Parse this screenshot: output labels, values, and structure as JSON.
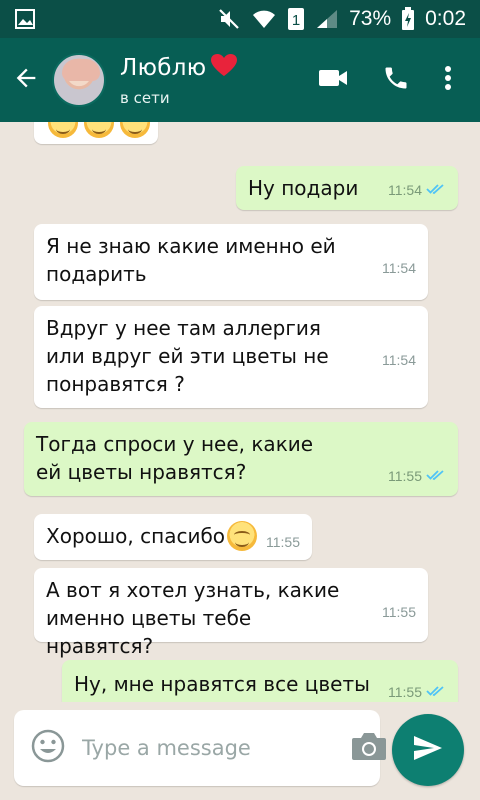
{
  "status_bar": {
    "battery": "73%",
    "time": "0:02",
    "sim_slot": "1"
  },
  "header": {
    "contact_name": "Люблю",
    "presence": "в сети",
    "icons": [
      "back-arrow-icon",
      "video-call-icon",
      "phone-icon",
      "more-vert-icon"
    ]
  },
  "messages": [
    {
      "dir": "in",
      "text": "",
      "emojis": 3,
      "time": ""
    },
    {
      "dir": "out",
      "text": "Ну подари",
      "time": "11:54",
      "read": true
    },
    {
      "dir": "in",
      "text": "Я не знаю какие именно ей подарить",
      "time": "11:54"
    },
    {
      "dir": "in",
      "text": "Вдруг у нее там аллергия или вдруг ей эти цветы не понравятся ?",
      "time": "11:54"
    },
    {
      "dir": "out",
      "text": "Тогда спроси у нее, какие ей цветы нравятся?",
      "time": "11:55",
      "read": true
    },
    {
      "dir": "in",
      "text": "Хорошо, спасибо",
      "time": "11:55",
      "emoji_after": true
    },
    {
      "dir": "in",
      "text": "А вот я хотел узнать, какие именно цветы тебе нравятся?",
      "time": "11:55"
    },
    {
      "dir": "out",
      "text": "Ну, мне нравятся все цветы",
      "time": "11:55",
      "read": true
    }
  ],
  "composer": {
    "placeholder": "Type a message",
    "icons": [
      "emoji-icon",
      "camera-icon",
      "send-icon"
    ]
  },
  "colors": {
    "statusbar": "#0b4f47",
    "appbar": "#075e54",
    "incoming": "#ffffff",
    "outgoing": "#dcf8c6",
    "read_tick": "#4fc3f7",
    "send_button": "#0d7f71",
    "heart": "#e8233b"
  }
}
